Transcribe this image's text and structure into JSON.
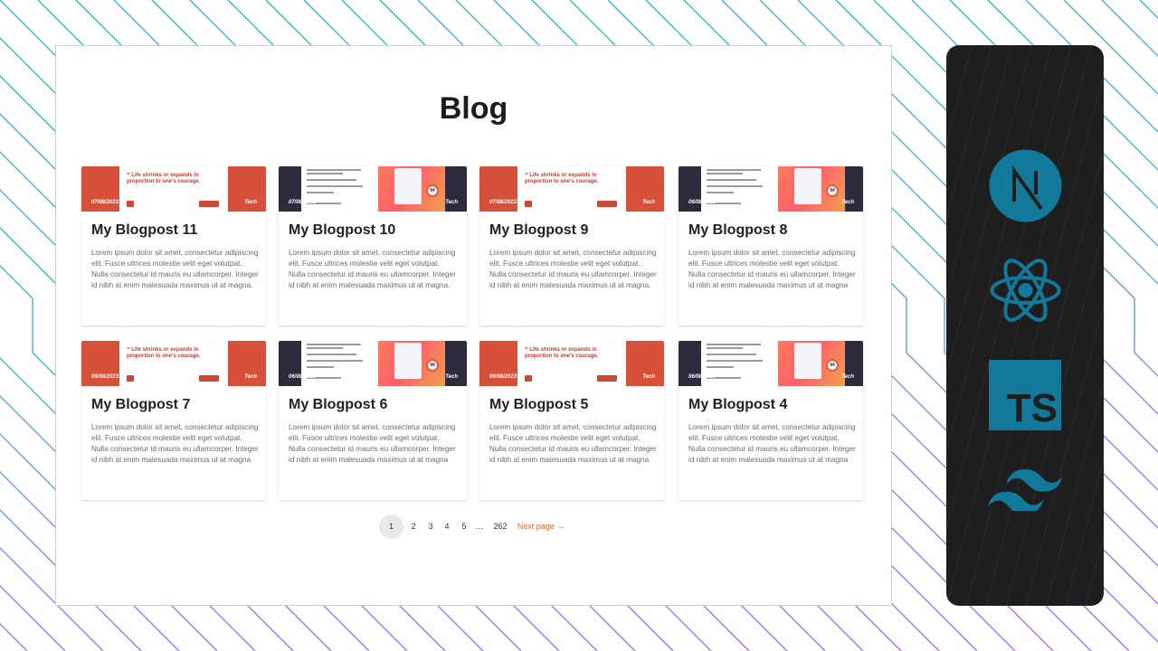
{
  "page": {
    "title": "Blog",
    "accent_color": "#e4682e",
    "tech_color": "#13799b",
    "panel_bg": "#1e1e1e"
  },
  "posts": [
    {
      "title": "My Blogpost 11",
      "date": "07/08/2023",
      "category": "Tech",
      "thumb": "red",
      "excerpt": "Lorem ipsum dolor sit amet, consectetur adipiscing elit. Fusce ultrices molestie velit eget volutpat. Nulla consectetur id mauris eu ullamcorper. Integer id nibh at enim malesuada maximus ut at magna."
    },
    {
      "title": "My Blogpost 10",
      "date": "07/08/2023",
      "category": "Tech",
      "thumb": "dark",
      "excerpt": "Lorem ipsum dolor sit amet, consectetur adipiscing elit. Fusce ultrices molestie velit eget volutpat. Nulla consectetur id mauris eu ullamcorper. Integer id nibh at enim malesuada maximus ut at magna."
    },
    {
      "title": "My Blogpost 9",
      "date": "07/08/2023",
      "category": "Tech",
      "thumb": "red",
      "excerpt": "Lorem ipsum dolor sit amet, consectetur adipiscing elit. Fusce ultrices molestie velit eget volutpat. Nulla consectetur id mauris eu ullamcorper. Integer id nibh at enim malesuada maximus ut at magna."
    },
    {
      "title": "My Blogpost 8",
      "date": "06/08/2023",
      "category": "Tech",
      "thumb": "dark",
      "excerpt": "Lorem ipsum dolor sit amet, consectetur adipiscing elit. Fusce ultrices molestie velit eget volutpat. Nulla consectetur id mauris eu ullamcorper. Integer id nibh at enim malesuada maximus ut at magna"
    },
    {
      "title": "My Blogpost 7",
      "date": "06/08/2023",
      "category": "Tech",
      "thumb": "red",
      "excerpt": "Lorem ipsum dolor sit amet, consectetur adipiscing elit. Fusce ultrices molestie velit eget volutpat. Nulla consectetur id mauris eu ullamcorper. Integer id nibh at enim malesuada maximus ut at magna"
    },
    {
      "title": "My Blogpost 6",
      "date": "06/08/2023",
      "category": "Tech",
      "thumb": "dark",
      "excerpt": "Lorem ipsum dolor sit amet, consectetur adipiscing elit. Fusce ultrices molestie velit eget volutpat. Nulla consectetur id mauris eu ullamcorper. Integer id nibh at enim malesuada maximus ut at magna"
    },
    {
      "title": "My Blogpost 5",
      "date": "06/08/2023",
      "category": "Tech",
      "thumb": "red",
      "excerpt": "Lorem ipsum dolor sit amet, consectetur adipiscing elit. Fusce ultrices molestie velit eget volutpat. Nulla consectetur id mauris eu ullamcorper. Integer id nibh at enim malesuada maximus ut at magna"
    },
    {
      "title": "My Blogpost 4",
      "date": "06/08/2023",
      "category": "Tech",
      "thumb": "dark",
      "excerpt": "Lorem ipsum dolor sit amet, consectetur adipiscing elit. Fusce ultrices molestie velit eget volutpat. Nulla consectetur id mauris eu ullamcorper. Integer id nibh at enim malesuada maximus ut at magna"
    }
  ],
  "thumb_text": {
    "quote": "❝ Life shrinks or expands in proportion to one's courage."
  },
  "pagination": {
    "pages": [
      "1",
      "2",
      "3",
      "4",
      "5",
      "…",
      "262"
    ],
    "current": "1",
    "next_label": "Next page →"
  },
  "tech_stack": {
    "icons": [
      "nextjs-icon",
      "react-icon",
      "typescript-icon",
      "tailwind-icon"
    ],
    "ts_label": "TS"
  }
}
